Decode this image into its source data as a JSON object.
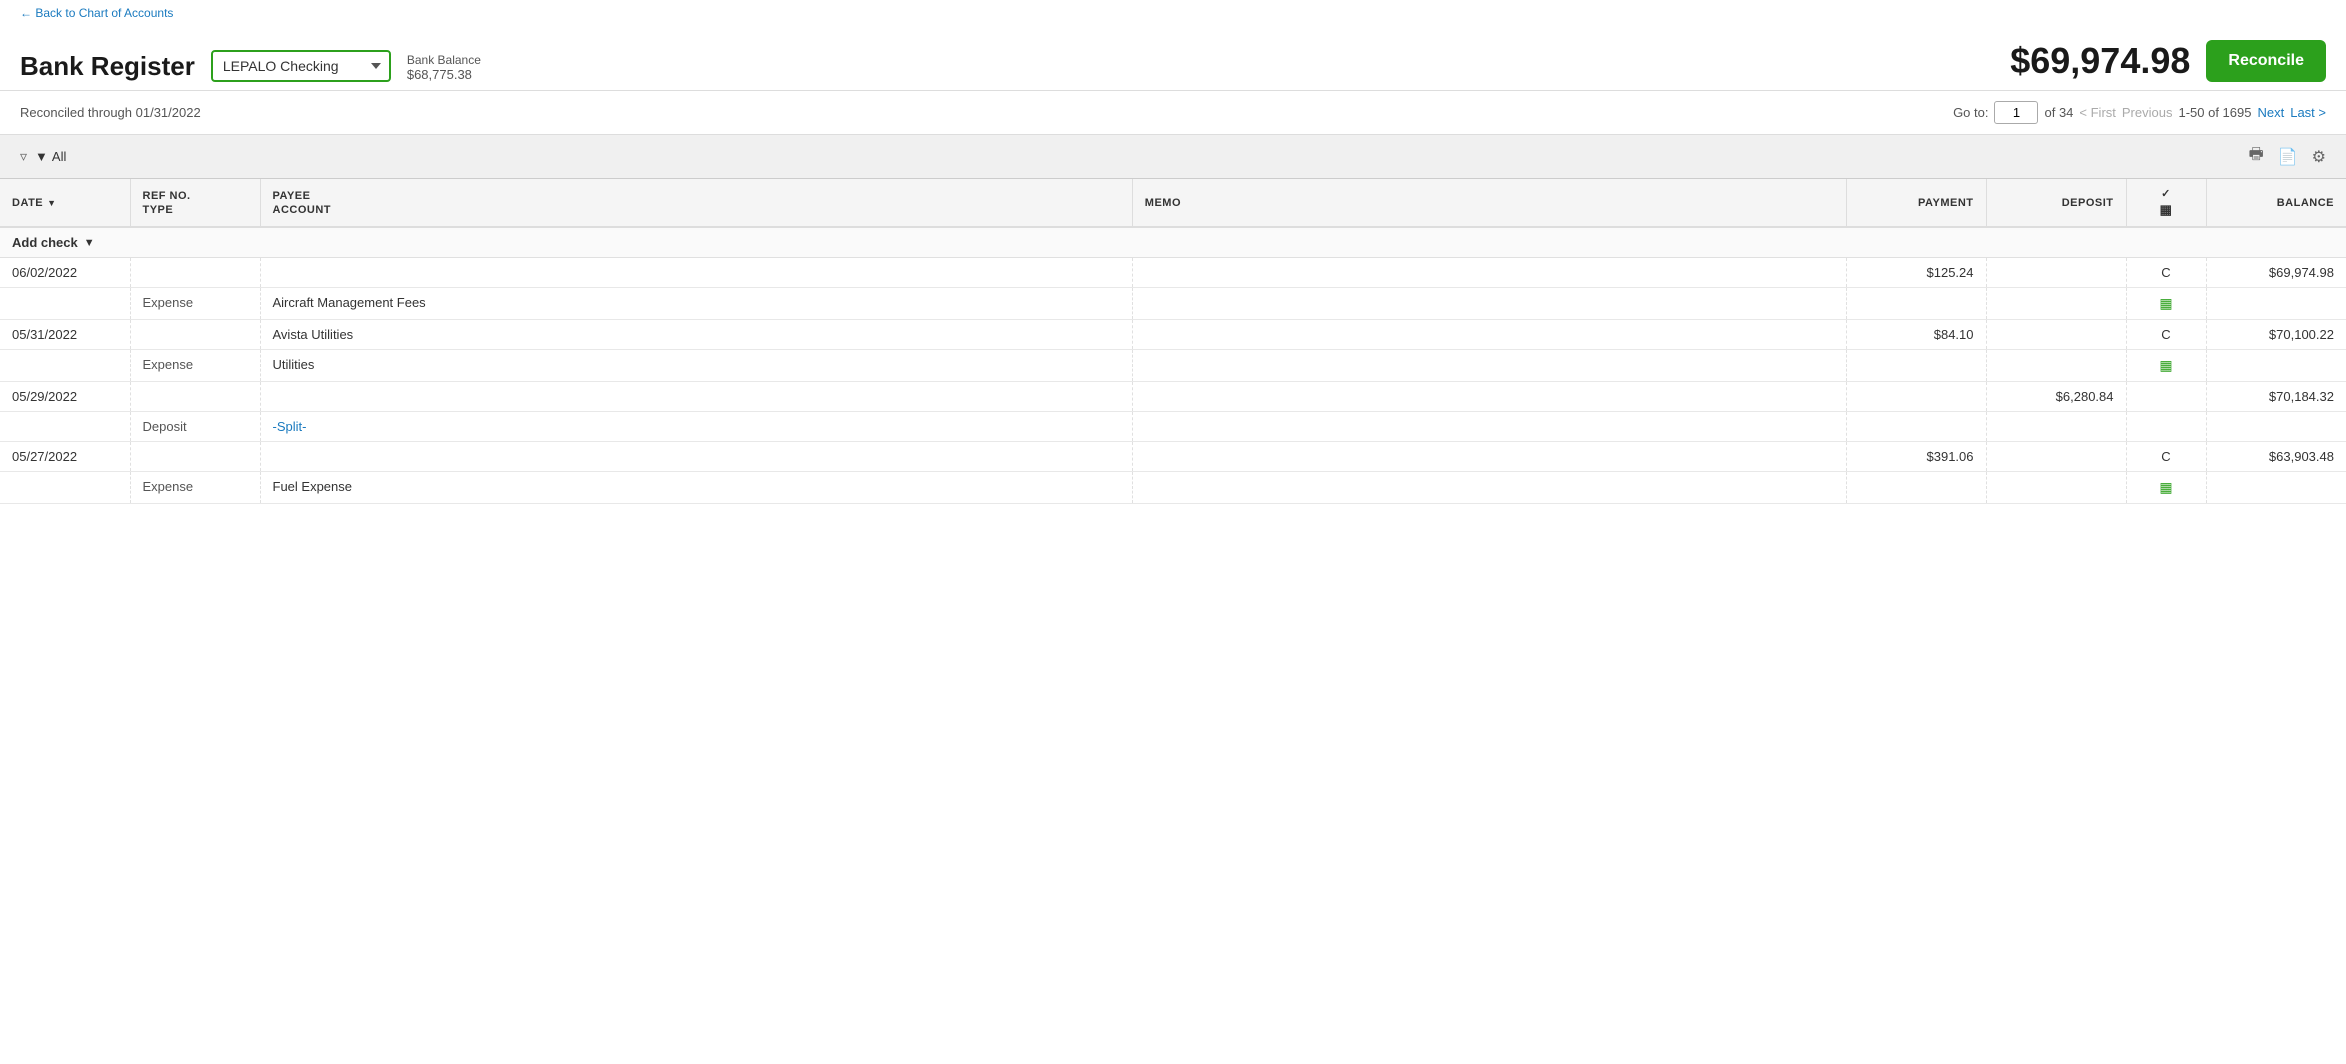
{
  "back_link": "Back to Chart of Accounts",
  "page_title": "Bank Register",
  "account": {
    "selected": "LEPALO Checking",
    "options": [
      "LEPALO Checking"
    ]
  },
  "bank_balance": {
    "label": "Bank Balance",
    "amount": "$68,775.38"
  },
  "balance_display": "$69,974.98",
  "reconcile_btn": "Reconcile",
  "reconciled_through": "Reconciled through 01/31/2022",
  "pagination": {
    "goto_label": "Go to:",
    "current_page": "1",
    "of_total": "of 34",
    "first": "< First",
    "previous": "Previous",
    "page_range": "1-50 of 1695",
    "next": "Next",
    "last": "Last >"
  },
  "filter": {
    "label": "All"
  },
  "columns": {
    "date": "DATE",
    "ref_no": "REF NO.",
    "type": "TYPE",
    "payee": "PAYEE",
    "account": "ACCOUNT",
    "memo": "MEMO",
    "payment": "PAYMENT",
    "deposit": "DEPOSIT",
    "balance": "BALANCE"
  },
  "add_check": "Add check",
  "rows": [
    {
      "date": "06/02/2022",
      "ref_no": "",
      "type": "Expense",
      "payee": "",
      "account": "Aircraft Management Fees",
      "memo": "",
      "payment": "$125.24",
      "deposit": "",
      "check_status": "C",
      "has_copy_icon": true,
      "balance": "$69,974.98"
    },
    {
      "date": "05/31/2022",
      "ref_no": "",
      "type": "Expense",
      "payee": "Avista Utilities",
      "account": "Utilities",
      "memo": "",
      "payment": "$84.10",
      "deposit": "",
      "check_status": "C",
      "has_copy_icon": true,
      "balance": "$70,100.22"
    },
    {
      "date": "05/29/2022",
      "ref_no": "",
      "type": "Deposit",
      "payee": "",
      "account": "-Split-",
      "account_is_link": true,
      "memo": "",
      "payment": "",
      "deposit": "$6,280.84",
      "check_status": "",
      "has_copy_icon": false,
      "balance": "$70,184.32"
    },
    {
      "date": "05/27/2022",
      "ref_no": "",
      "type": "Expense",
      "payee": "",
      "account": "Fuel Expense",
      "memo": "",
      "payment": "$391.06",
      "deposit": "",
      "check_status": "C",
      "has_copy_icon": true,
      "balance": "$63,903.48"
    }
  ]
}
